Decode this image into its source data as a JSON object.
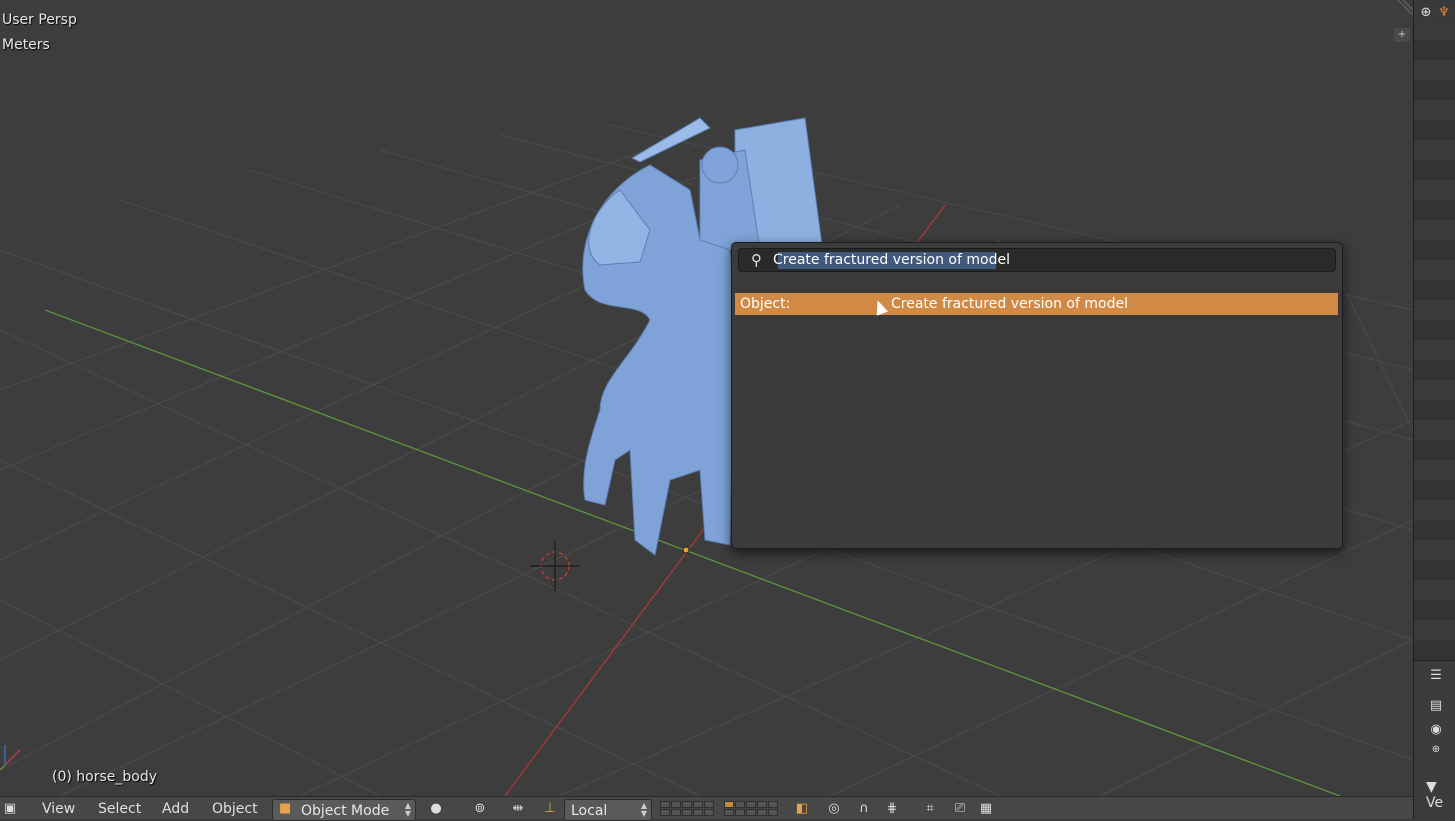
{
  "viewport": {
    "view_name": "User Persp",
    "units": "Meters",
    "active_object": "(0) horse_body"
  },
  "search_popup": {
    "query": "Create fractured version of model",
    "results": [
      {
        "category": "Object:",
        "label": "Create fractured version of model"
      }
    ]
  },
  "header": {
    "menus": [
      "View",
      "Select",
      "Add",
      "Object"
    ],
    "mode": "Object Mode",
    "orientation": "Local"
  },
  "right_panel": {
    "label": "Ve"
  },
  "colors": {
    "viewport_bg": "#3d3d3d",
    "grid": "#4b4b4b",
    "x_axis": "#b03a3a",
    "y_axis": "#5f9e3a",
    "model": "#7fa3d8",
    "highlight": "#d18a45"
  },
  "icons": {
    "search": "search-icon",
    "cursor": "3d-cursor-icon",
    "mode": "cube-icon",
    "shading": "sphere-icon",
    "pivot": "pivot-icon",
    "manipulator": "transform-manipulator-icon",
    "snap": "magnet-icon",
    "render": "camera-icon"
  }
}
